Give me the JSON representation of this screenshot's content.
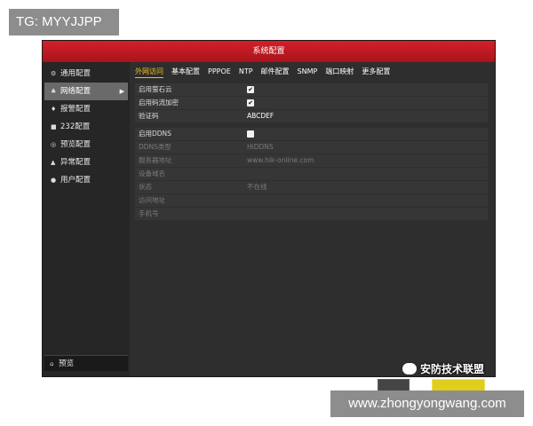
{
  "overlay": {
    "top_left_tag": "TG: MYYJJPP",
    "bottom_right_url": "www.zhongyongwang.com"
  },
  "window": {
    "title": "系统配置"
  },
  "sidebar": {
    "items": [
      {
        "label": "通用配置",
        "icon": "gear-icon"
      },
      {
        "label": "网络配置",
        "icon": "network-icon",
        "active": true
      },
      {
        "label": "报警配置",
        "icon": "alarm-bell-icon"
      },
      {
        "label": "232配置",
        "icon": "serial-port-icon"
      },
      {
        "label": "预览配置",
        "icon": "eye-icon"
      },
      {
        "label": "异常配置",
        "icon": "warning-icon"
      },
      {
        "label": "用户配置",
        "icon": "user-icon"
      }
    ],
    "bottom": {
      "label": "预览",
      "icon": "home-icon"
    }
  },
  "tabs": [
    "外网访问",
    "基本配置",
    "PPPOE",
    "NTP",
    "邮件配置",
    "SNMP",
    "端口映射",
    "更多配置"
  ],
  "active_tab": "外网访问",
  "rows": [
    {
      "label": "启用萤石云",
      "type": "checkbox",
      "checked": true
    },
    {
      "label": "启用码流加密",
      "type": "checkbox",
      "checked": true
    },
    {
      "label": "验证码",
      "value": "ABCDEF"
    },
    {
      "label": "启用DDNS",
      "type": "checkbox",
      "checked": false
    },
    {
      "label": "DDNS类型",
      "value": "HiDDNS",
      "disabled": true
    },
    {
      "label": "服务器地址",
      "value": "www.hik-online.com",
      "disabled": true
    },
    {
      "label": "设备域名",
      "disabled": true
    },
    {
      "label": "状态",
      "value": "不在线",
      "disabled": true
    },
    {
      "label": "访问地址",
      "disabled": true
    },
    {
      "label": "手机号",
      "disabled": true
    }
  ],
  "watermark": {
    "text": "安防技术联盟",
    "icon": "wechat-icon"
  },
  "colors": {
    "title_bar": "#c8181f",
    "active_tab": "#f0c020",
    "apply_button": "#e0cd1c"
  }
}
